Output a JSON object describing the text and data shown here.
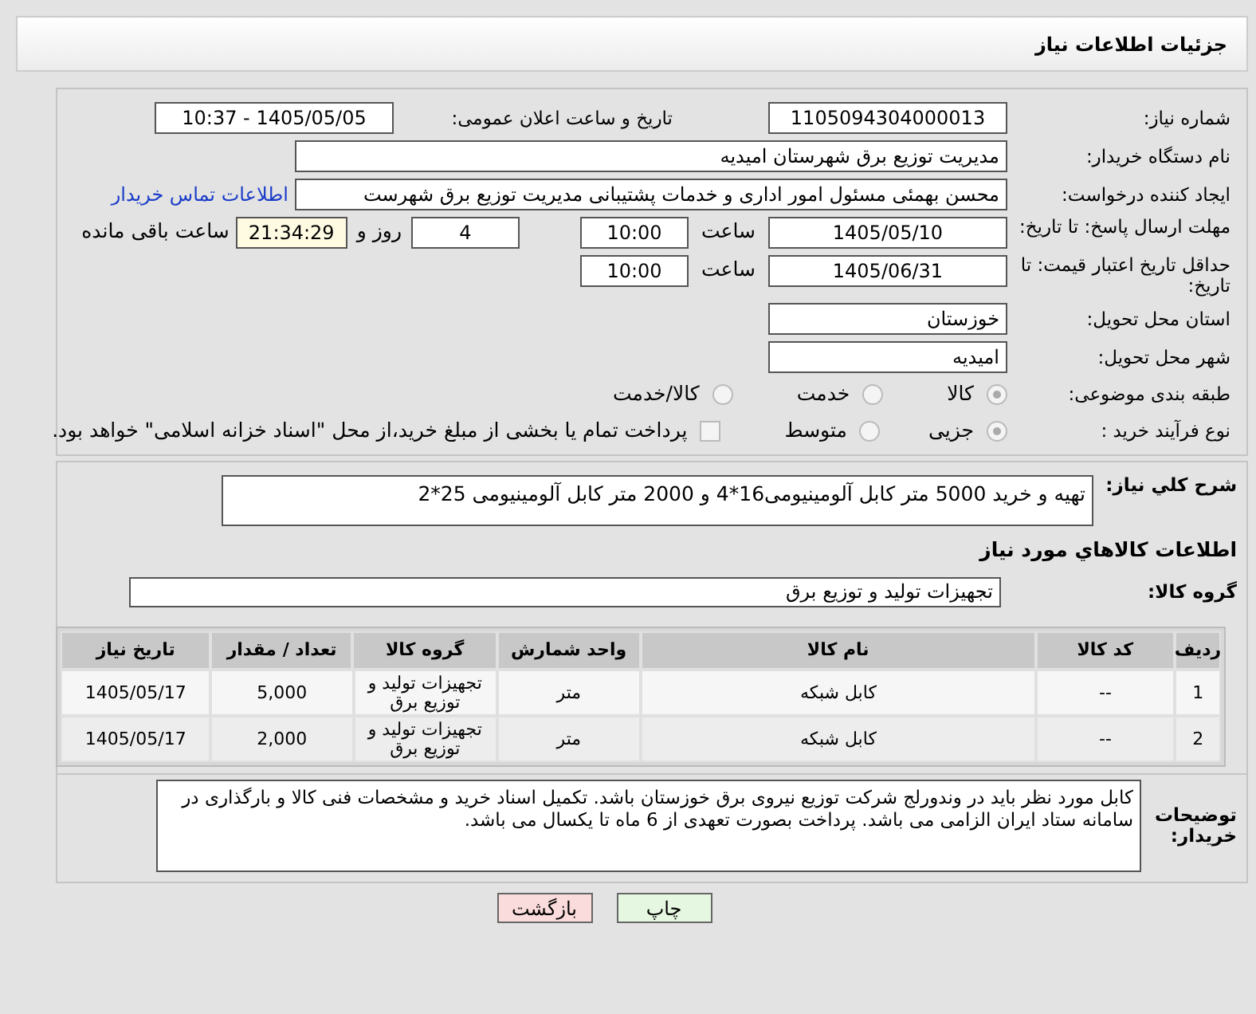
{
  "header": {
    "title": "جزئیات اطلاعات نیاز"
  },
  "need_number": {
    "label": "شماره نیاز:",
    "value": "1105094304000013"
  },
  "announce": {
    "label": "تاریخ و ساعت اعلان عمومی:",
    "value": "1405/05/05 - 10:37"
  },
  "buyer": {
    "label": "نام دستگاه خریدار:",
    "value": "مدیریت توزیع برق شهرستان امیدیه"
  },
  "creator": {
    "label": "ایجاد کننده درخواست:",
    "value": "محسن بهمئی مسئول امور اداری و خدمات پشتیبانی مدیریت توزیع برق شهرست",
    "link": "اطلاعات تماس خریدار"
  },
  "deadline": {
    "label": "مهلت ارسال پاسخ: تا تاریخ:",
    "date": "1405/05/10",
    "time_label": "ساعت",
    "time": "10:00",
    "days": "4",
    "days_label": "روز و",
    "remaining": "21:34:29",
    "remaining_label": "ساعت باقی مانده"
  },
  "validity": {
    "label": "حداقل تاریخ اعتبار قیمت: تا تاریخ:",
    "date": "1405/06/31",
    "time_label": "ساعت",
    "time": "10:00"
  },
  "province": {
    "label": "استان محل تحویل:",
    "value": "خوزستان"
  },
  "city": {
    "label": "شهر محل تحویل:",
    "value": "امیدیه"
  },
  "category": {
    "label": "طبقه بندی موضوعی:",
    "options": [
      {
        "label": "کالا",
        "selected": true
      },
      {
        "label": "خدمت",
        "selected": false
      },
      {
        "label": "کالا/خدمت",
        "selected": false
      }
    ]
  },
  "process": {
    "label": "نوع فرآیند خرید :",
    "options": [
      {
        "label": "جزیی",
        "selected": true
      },
      {
        "label": "متوسط",
        "selected": false
      }
    ],
    "payment": {
      "label": "پرداخت تمام یا بخشی از مبلغ خرید،از محل \"اسناد خزانه اسلامی\" خواهد بود.",
      "checked": false
    }
  },
  "description": {
    "label": "شرح كلي نياز:",
    "value": "تهیه و خرید 5000 متر کابل آلومینیومی16*4 و 2000 متر کابل آلومینیومی 25*2"
  },
  "goods_title": "اطلاعات كالاهاي مورد نياز",
  "goods_group": {
    "label": "گروه کالا:",
    "value": "تجهیزات تولید و توزیع برق"
  },
  "table": {
    "columns": [
      "ردیف",
      "کد کالا",
      "نام کالا",
      "واحد شمارش",
      "گروه کالا",
      "تعداد / مقدار",
      "تاریخ نیاز"
    ],
    "rows": [
      [
        "1",
        "--",
        "کابل شبکه",
        "متر",
        "تجهیزات تولید و توزیع برق",
        "5,000",
        "1405/05/17"
      ],
      [
        "2",
        "--",
        "کابل شبکه",
        "متر",
        "تجهیزات تولید و توزیع برق",
        "2,000",
        "1405/05/17"
      ]
    ]
  },
  "buyer_notes": {
    "label": "توضیحات خریدار:",
    "value": "کابل مورد نظر باید در وندورلج شرکت توزیع نیروی برق خوزستان باشد. تکمیل اسناد خرید و مشخصات فنی کالا و بارگذاری در سامانه ستاد ایران الزامی می باشد. پرداخت بصورت تعهدی از 6 ماه تا یکسال می باشد."
  },
  "buttons": [
    {
      "label": "چاپ",
      "kind": "print"
    },
    {
      "label": "بازگشت",
      "kind": "back"
    }
  ]
}
